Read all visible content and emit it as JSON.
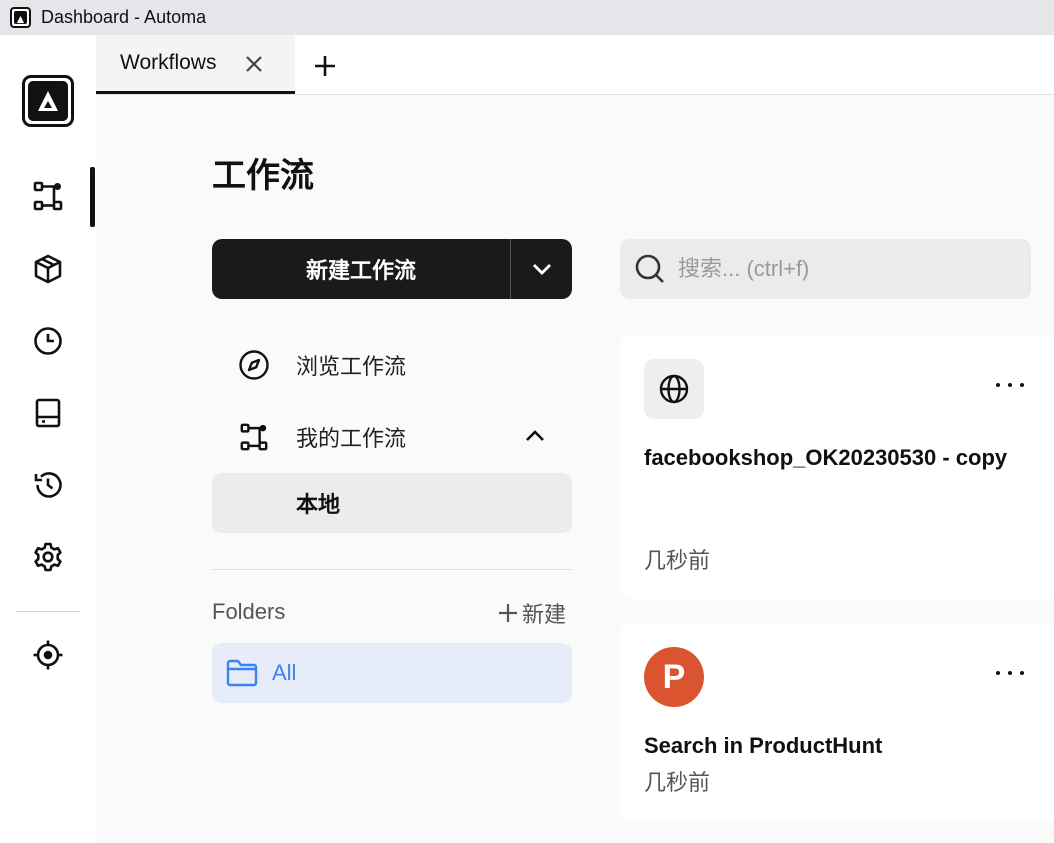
{
  "window": {
    "title": "Dashboard - Automa"
  },
  "tabs": {
    "items": [
      {
        "label": "Workflows"
      }
    ]
  },
  "sidebar": {
    "icons": [
      "workflow-icon",
      "package-icon",
      "clock-icon",
      "storage-icon",
      "history-icon",
      "settings-icon",
      "crosshair-icon"
    ],
    "active_index": 0
  },
  "page": {
    "title": "工作流",
    "new_button": "新建工作流",
    "search_placeholder": "搜索... (ctrl+f)",
    "menu": {
      "browse": "浏览工作流",
      "mine": "我的工作流",
      "local": "本地"
    },
    "folders": {
      "label": "Folders",
      "new_label": "新建",
      "all": "All"
    }
  },
  "workflows": [
    {
      "name": "facebookshop_OK20230530 - copy",
      "time": "几秒前",
      "icon": "globe-icon"
    },
    {
      "name": "Search in ProductHunt",
      "time": "几秒前",
      "icon": "producthunt-icon",
      "icon_color": "#da552f",
      "icon_letter": "P"
    }
  ]
}
